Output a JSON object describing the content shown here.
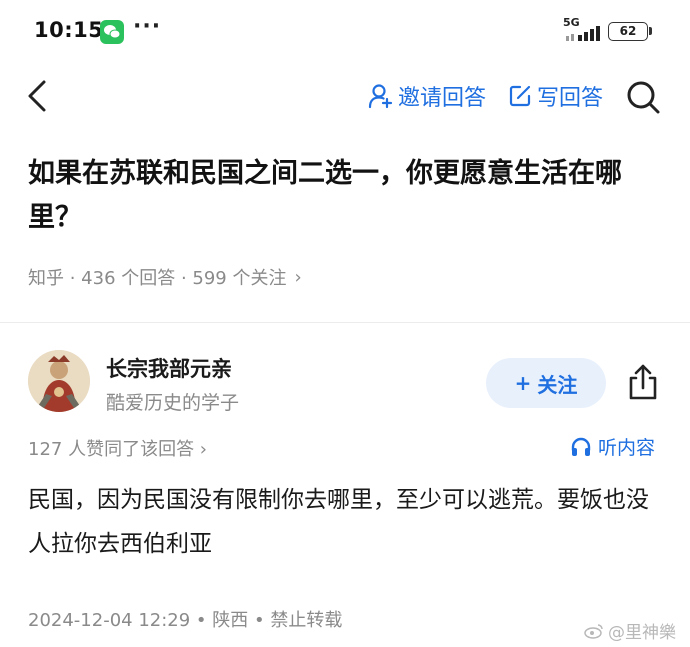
{
  "status_bar": {
    "time": "10:15",
    "network": "5G",
    "battery": "62",
    "more": "···",
    "icons": [
      "wechat-icon",
      "signal-icon",
      "battery-icon"
    ]
  },
  "nav": {
    "back_icon": "chevron-left-icon",
    "invite_label": "邀请回答",
    "write_label": "写回答",
    "search_icon": "search-icon",
    "accent_color": "#1f6fe0"
  },
  "question": {
    "title": "如果在苏联和民国之间二选一，你更愿意生活在哪里？",
    "meta": "知乎 · 436 个回答 · 599 个关注",
    "chevron": "›"
  },
  "answer": {
    "author_name": "长宗我部元亲",
    "author_bio": "酷爱历史的学子",
    "follow_label": "关注",
    "follow_plus": "+",
    "upvote_text": "127 人赞同了该回答 ›",
    "listen_label": "听内容",
    "content": "民国，因为民国没有限制你去哪里，至少可以逃荒。要饭也没人拉你去西伯利亚",
    "footer": "2024-12-04 12:29 • 陕西 • 禁止转载"
  },
  "watermark": {
    "text": "@里神樂"
  }
}
